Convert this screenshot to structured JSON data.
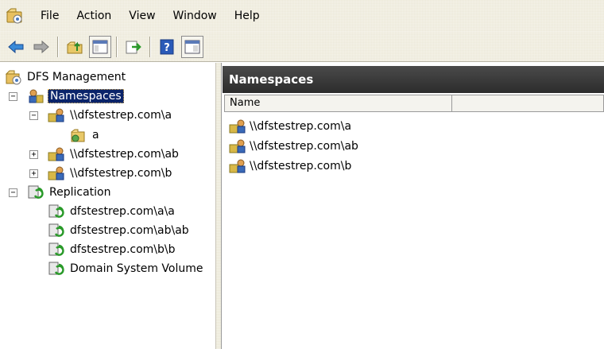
{
  "menu": [
    "File",
    "Action",
    "View",
    "Window",
    "Help"
  ],
  "toolbar": {
    "buttons": [
      "back-icon",
      "forward-icon",
      "up-folder-icon",
      "show-hide-tree-icon",
      "export-list-icon",
      "help-icon",
      "console-icon"
    ]
  },
  "tree": {
    "root": "DFS Management",
    "namespaces": {
      "label": "Namespaces",
      "items": [
        {
          "label": "\\\\dfstestrep.com\\a",
          "expanded": true,
          "children": [
            "a"
          ]
        },
        {
          "label": "\\\\dfstestrep.com\\ab",
          "expanded": false,
          "children": []
        },
        {
          "label": "\\\\dfstestrep.com\\b",
          "expanded": false,
          "children": []
        }
      ]
    },
    "replication": {
      "label": "Replication",
      "items": [
        "dfstestrep.com\\a\\a",
        "dfstestrep.com\\ab\\ab",
        "dfstestrep.com\\b\\b",
        "Domain System Volume"
      ]
    }
  },
  "main": {
    "header": "Namespaces",
    "columns": [
      "Name"
    ],
    "rows": [
      "\\\\dfstestrep.com\\a",
      "\\\\dfstestrep.com\\ab",
      "\\\\dfstestrep.com\\b"
    ]
  },
  "colors": {
    "selection": "#0a246a",
    "header_bar": "#3a3a3a",
    "chrome": "#ece9d8"
  }
}
